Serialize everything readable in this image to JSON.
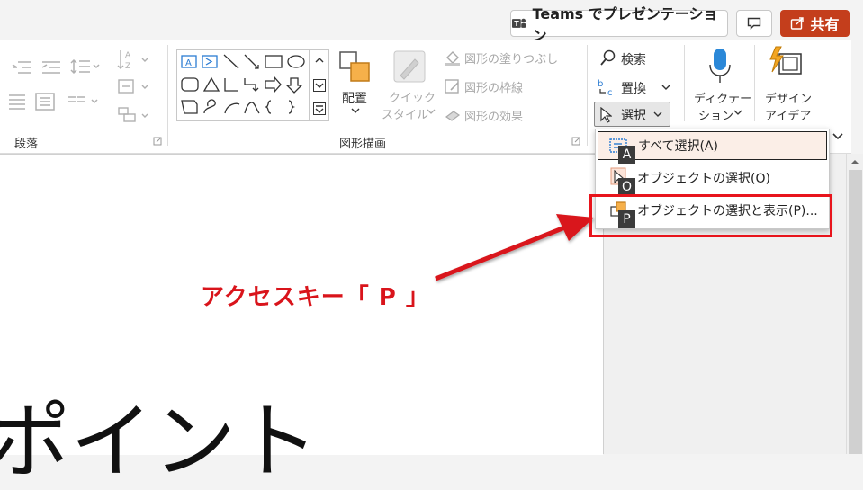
{
  "topbar": {
    "teams_label": "Teams でプレゼンテーション",
    "share_label": "共有",
    "share_color": "#c43e1c"
  },
  "ribbon": {
    "groups": {
      "paragraph": "段落",
      "drawing": "図形描画"
    },
    "arrange_label": "配置",
    "quick_style_line1": "クイック",
    "quick_style_line2": "スタイル",
    "shape_fill": "図形の塗りつぶし",
    "shape_outline": "図形の枠線",
    "shape_effects": "図形の効果",
    "find": "検索",
    "replace": "置換",
    "select": "選択",
    "dictate_line1": "ディクテー",
    "dictate_line2": "ション",
    "designer_line1": "デザイン",
    "designer_line2": "アイデア",
    "shape_textbox_label": "A"
  },
  "select_menu": {
    "items": [
      {
        "label": "すべて選択(A)",
        "keytip": "A"
      },
      {
        "label": "オブジェクトの選択(O)",
        "keytip": "O"
      },
      {
        "label": "オブジェクトの選択と表示(P)...",
        "keytip": "P"
      }
    ]
  },
  "annotation": {
    "text": "アクセスキー「 P 」",
    "color": "#d9141b"
  },
  "slide": {
    "text": "ポイント"
  },
  "icons": {
    "teams": "teams-icon",
    "comment": "comment-icon",
    "share": "share-icon",
    "find": "search-icon",
    "replace": "replace-icon",
    "select": "cursor-icon",
    "dictate": "microphone-icon",
    "designer": "designer-icon"
  }
}
